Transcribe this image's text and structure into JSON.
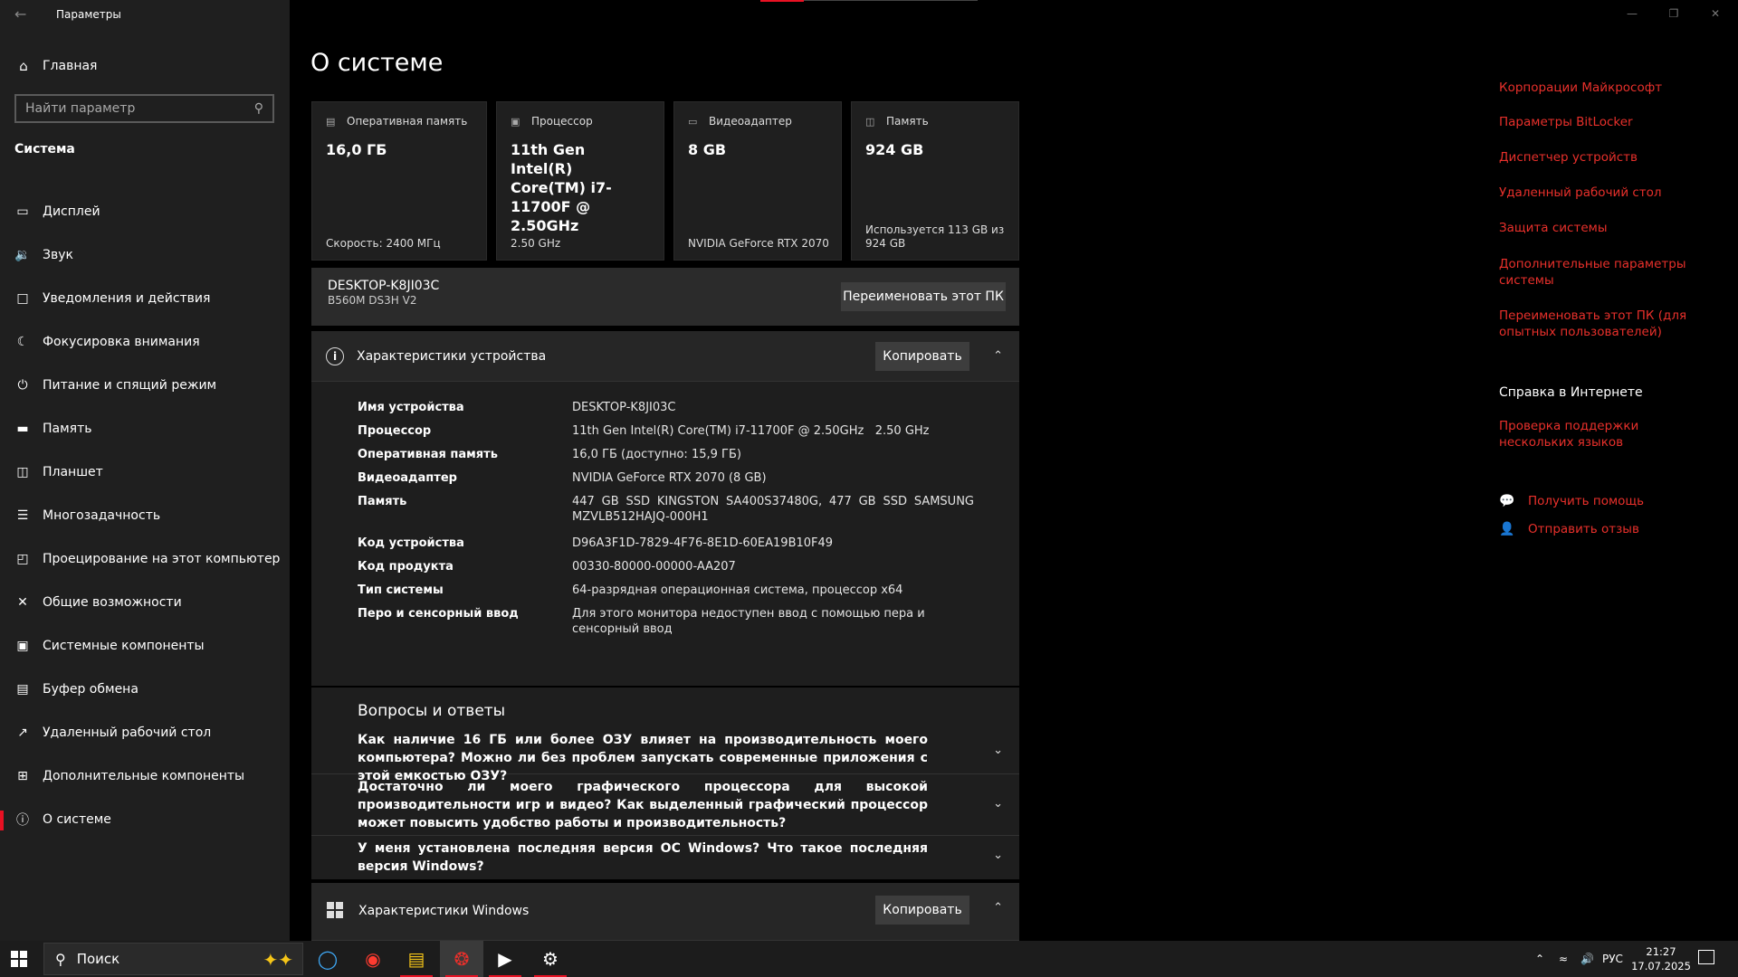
{
  "window": {
    "title": "Параметры"
  },
  "sidebar": {
    "home": "Главная",
    "search_placeholder": "Найти параметр",
    "section": "Система",
    "items": [
      {
        "label": "Дисплей",
        "icon": "display-icon"
      },
      {
        "label": "Звук",
        "icon": "sound-icon"
      },
      {
        "label": "Уведомления и действия",
        "icon": "notifications-icon"
      },
      {
        "label": "Фокусировка внимания",
        "icon": "moon-icon"
      },
      {
        "label": "Питание и спящий режим",
        "icon": "power-icon"
      },
      {
        "label": "Память",
        "icon": "storage-icon"
      },
      {
        "label": "Планшет",
        "icon": "tablet-icon"
      },
      {
        "label": "Многозадачность",
        "icon": "multitasking-icon"
      },
      {
        "label": "Проецирование на этот компьютер",
        "icon": "projection-icon"
      },
      {
        "label": "Общие возможности",
        "icon": "shared-icon"
      },
      {
        "label": "Системные компоненты",
        "icon": "components-icon"
      },
      {
        "label": "Буфер обмена",
        "icon": "clipboard-icon"
      },
      {
        "label": "Удаленный рабочий стол",
        "icon": "remote-icon"
      },
      {
        "label": "Дополнительные компоненты",
        "icon": "extra-icon"
      },
      {
        "label": "О системе",
        "icon": "info-icon",
        "active": true
      }
    ]
  },
  "main": {
    "title": "О системе",
    "cards": [
      {
        "header": "Оперативная память",
        "value": "16,0 ГБ",
        "sub": "Скорость: 2400 МГц"
      },
      {
        "header": "Процессор",
        "value": "11th Gen Intel(R) Core(TM) i7-11700F @ 2.50GHz",
        "sub": "2.50 GHz"
      },
      {
        "header": "Видеоадаптер",
        "value": "8 GB",
        "sub": "NVIDIA GeForce RTX 2070"
      },
      {
        "header": "Память",
        "value": "924 GB",
        "sub": "Используется 113 GB из 924 GB"
      }
    ],
    "pc": {
      "name": "DESKTOP-K8JI03C",
      "board": "B560M DS3H V2",
      "rename_button": "Переименовать этот ПК"
    },
    "device_specs": {
      "title": "Характеристики устройства",
      "copy_button": "Копировать",
      "rows": [
        {
          "key": "Имя устройства",
          "value": "DESKTOP-K8JI03C"
        },
        {
          "key": "Процессор",
          "value": "11th Gen Intel(R) Core(TM) i7-11700F @ 2.50GHz   2.50 GHz"
        },
        {
          "key": "Оперативная память",
          "value": "16,0 ГБ (доступно: 15,9 ГБ)"
        },
        {
          "key": "Видеоадаптер",
          "value": "NVIDIA GeForce RTX 2070 (8 GB)"
        },
        {
          "key": "Память",
          "value": "447 GB SSD KINGSTON SA400S37480G, 477 GB SSD SAMSUNG MZVLB512HAJQ-000H1"
        },
        {
          "key": "Код устройства",
          "value": "D96A3F1D-7829-4F76-8E1D-60EA19B10F49"
        },
        {
          "key": "Код продукта",
          "value": "00330-80000-00000-AA207"
        },
        {
          "key": "Тип системы",
          "value": "64-разрядная операционная система, процессор x64"
        },
        {
          "key": "Перо и сенсорный ввод",
          "value": "Для этого монитора недоступен ввод с помощью пера и сенсорный ввод"
        }
      ]
    },
    "faq": {
      "title": "Вопросы и ответы",
      "items": [
        "Как наличие 16 ГБ или более ОЗУ влияет на производительность моего компьютера? Можно ли без проблем запускать современные приложения с этой емкостью ОЗУ?",
        "Достаточно ли моего графического процессора для высокой производительности игр и видео? Как выделенный графический процессор может повысить удобство работы и производительность?",
        "У меня установлена последняя версия ОС Windows? Что такое последняя версия Windows?"
      ]
    },
    "windows_specs": {
      "title": "Характеристики Windows",
      "copy_button": "Копировать"
    }
  },
  "right": {
    "links": [
      "Корпорации Майкрософт",
      "Параметры BitLocker",
      "Диспетчер устройств",
      "Удаленный рабочий стол",
      "Защита системы",
      "Дополнительные параметры системы",
      "Переименовать этот ПК (для опытных пользователей)"
    ],
    "help_heading": "Справка в Интернете",
    "help_link": "Проверка поддержки нескольких языков",
    "get_help": "Получить помощь",
    "feedback": "Отправить отзыв"
  },
  "taskbar": {
    "search": "Поиск",
    "lang": "РУС",
    "time": "21:27",
    "date": "17.07.2025"
  },
  "colors": {
    "accent": "#e8302b",
    "sidebar_bg": "#1f1f1f",
    "panel_bg": "#262626"
  }
}
